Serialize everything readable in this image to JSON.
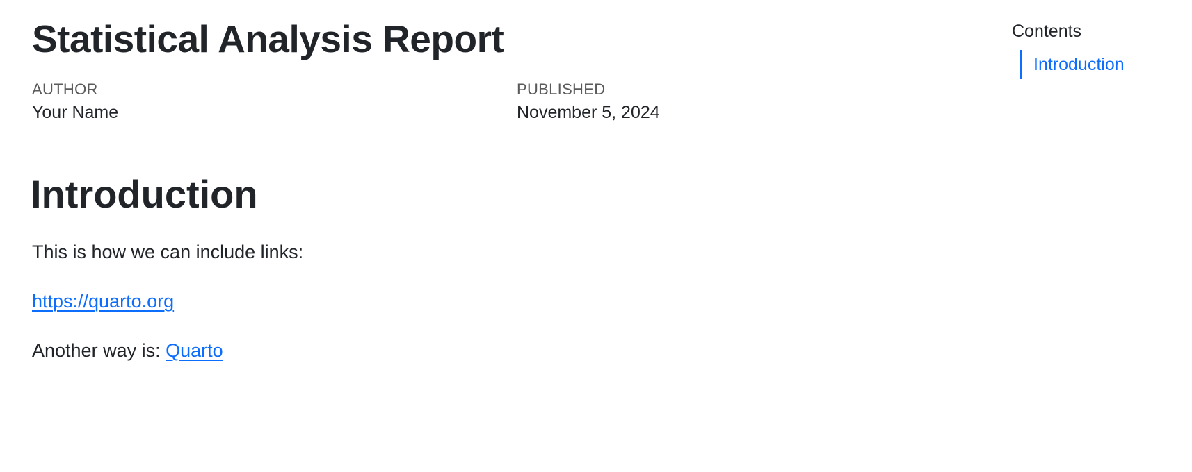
{
  "document": {
    "title": "Statistical Analysis Report",
    "meta": {
      "author_heading": "AUTHOR",
      "author": "Your Name",
      "published_heading": "PUBLISHED",
      "published": "November 5, 2024"
    }
  },
  "content": {
    "section_heading": "Introduction",
    "para_1": "This is how we can include links:",
    "link_1": "https://quarto.org",
    "para_3_prefix": "Another way is: ",
    "link_2": "Quarto"
  },
  "toc": {
    "title": "Contents",
    "items": [
      {
        "label": "Introduction"
      }
    ]
  },
  "colors": {
    "text": "#212529",
    "muted": "#5a5a5a",
    "link": "#0d6efd",
    "background": "#ffffff"
  }
}
